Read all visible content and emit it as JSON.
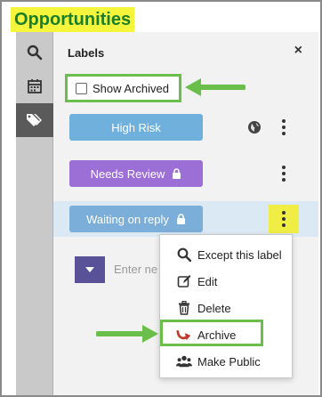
{
  "title": "Opportunities",
  "panel": {
    "heading": "Labels",
    "close_symbol": "×",
    "show_archived_label": "Show Archived"
  },
  "labels": [
    {
      "name": "High Risk",
      "color": "#6fb0dd",
      "locked": false,
      "public": true
    },
    {
      "name": "Needs Review",
      "color": "#9b6fd6",
      "locked": true,
      "public": false
    },
    {
      "name": "Waiting on reply",
      "color": "#7baed8",
      "locked": true,
      "public": false
    }
  ],
  "new_label": {
    "placeholder": "Enter ne",
    "button_color": "#5a5299"
  },
  "menu": {
    "items": [
      {
        "label": "Except this label",
        "icon": "search-icon"
      },
      {
        "label": "Edit",
        "icon": "edit-icon"
      },
      {
        "label": "Delete",
        "icon": "trash-icon"
      },
      {
        "label": "Archive",
        "icon": "archive-arrow-icon"
      },
      {
        "label": "Make Public",
        "icon": "group-icon"
      }
    ]
  },
  "colors": {
    "highlight_green": "#6abf4b",
    "title_highlight": "#f5f53c",
    "title_text": "#1b7f2a",
    "kebab_highlight": "#f0ee44"
  }
}
